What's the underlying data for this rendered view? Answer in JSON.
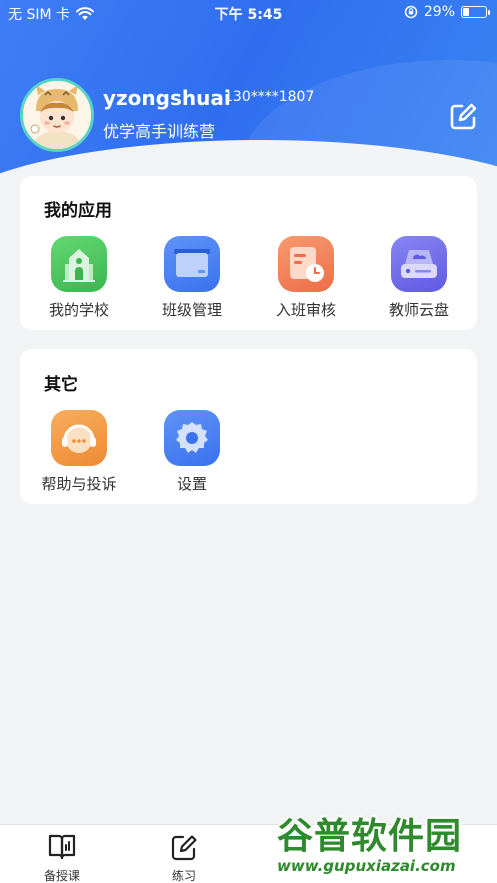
{
  "status_bar": {
    "carrier": "无 SIM 卡",
    "time": "下午 5:45",
    "battery_percent": "29%",
    "battery_level": 0.29,
    "icons": [
      "wifi-icon",
      "orientation-lock-icon",
      "battery-icon"
    ]
  },
  "profile": {
    "username": "yzongshuai",
    "phone": "130****1807",
    "org": "优学高手训练营",
    "edit_icon": "edit-icon"
  },
  "my_apps": {
    "title": "我的应用",
    "items": [
      {
        "label": "我的学校",
        "icon": "school-icon",
        "color": "#4cc65e"
      },
      {
        "label": "班级管理",
        "icon": "class-management-icon",
        "color": "#3f7ef5"
      },
      {
        "label": "入班审核",
        "icon": "enrollment-review-icon",
        "color": "#f07e55"
      },
      {
        "label": "教师云盘",
        "icon": "cloud-drive-icon",
        "color": "#6a66e8"
      }
    ]
  },
  "others": {
    "title": "其它",
    "items": [
      {
        "label": "帮助与投诉",
        "icon": "headset-icon",
        "color": "#f29a45"
      },
      {
        "label": "设置",
        "icon": "settings-gear-icon",
        "color": "#3f7ef5"
      }
    ]
  },
  "tab_bar": {
    "items": [
      {
        "label": "备授课",
        "icon": "lesson-book-icon"
      },
      {
        "label": "练习",
        "icon": "practice-edit-icon"
      }
    ]
  },
  "watermark": {
    "title": "谷普软件园",
    "url": "www.gupuxiazai.com"
  }
}
